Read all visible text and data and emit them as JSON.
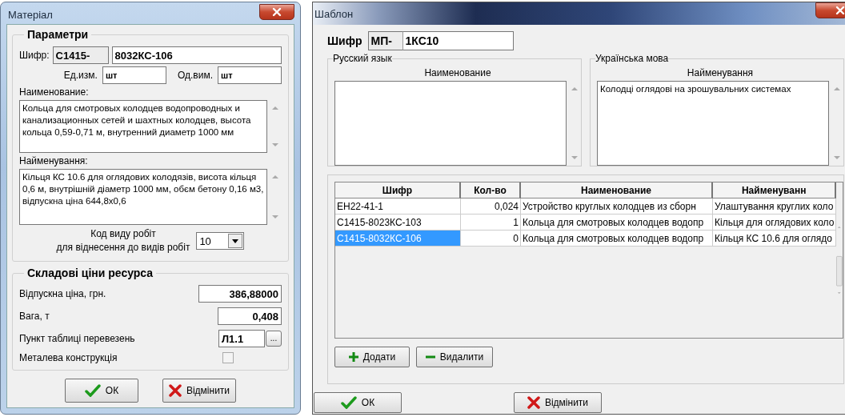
{
  "material_dialog": {
    "title": "Матеріал",
    "parameters": {
      "title": "Параметри",
      "code_label": "Шифр:",
      "code_prefix": "С1415-",
      "code_value": "8032КС-106",
      "unit_ru_label": "Ед.изм.",
      "unit_ru": "шт",
      "unit_ua_label": "Од.вим.",
      "unit_ua": "шт",
      "name_ru_label": "Наименование:",
      "name_ru": "Кольца для смотровых колодцев водопроводных и канализационных сетей и шахтных колодцев, высота кольца 0,59-0,71 м, внутренний диаметр 1000 мм",
      "name_ua_label": "Найменування:",
      "name_ua": "Кільця КС 10.6 для оглядових колодязів, висота кільця 0,6 м, внутрішній діаметр 1000 мм, обєм бетону 0,16 м3, відпускна ціна 644,8х0,6",
      "work_kind_label": "Код виду робіт\nдля віднесення до видів робіт",
      "work_kind_value": "10"
    },
    "price": {
      "title": "Складові ціни ресурса",
      "rows": [
        {
          "kind": "field",
          "label": "Відпускна ціна, грн.",
          "value": "386,88000"
        },
        {
          "kind": "field",
          "label": "Вага, т",
          "value": "0,408"
        },
        {
          "kind": "picker",
          "label": "Пункт таблиці перевезень",
          "value": "Л1.1",
          "button_text": "..."
        },
        {
          "kind": "checkbox",
          "label": "Металева конструкція",
          "checked": false
        }
      ]
    },
    "buttons": [
      {
        "label": "ОК",
        "kind": "ok"
      },
      {
        "label": "Відмінити",
        "kind": "cancel"
      }
    ]
  },
  "template_dialog": {
    "title": "Шаблон",
    "code_label": "Шифр",
    "code_prefix": "МП-",
    "code_value": "1КС10",
    "ru": {
      "group": "Русский язык",
      "label": "Наименование"
    },
    "ua": {
      "group": "Українська мова",
      "label": "Найменування",
      "text": "Колодці оглядові на зрошувальних системах"
    },
    "table": {
      "columns": [
        "Шифр",
        "Кол-во",
        "Наименование",
        "Найменуванн"
      ],
      "rows": [
        {
          "cells": [
            "ЕН22-41-1",
            "0,024",
            "Устройство круглых колодцев из сборн",
            "Улаштування круглих коло"
          ],
          "selected": false
        },
        {
          "cells": [
            "С1415-8023КС-103",
            "1",
            "Кольца для смотровых колодцев водопр",
            "Кільця для оглядових коло"
          ],
          "selected": false
        },
        {
          "cells": [
            "С1415-8032КС-106",
            "0",
            "Кольца для смотровых колодцев водопр",
            "Кільця КС 10.6 для оглядо"
          ],
          "selected": true
        }
      ]
    },
    "actions": [
      {
        "label": "Додати",
        "kind": "add"
      },
      {
        "label": "Видалити",
        "kind": "delete"
      }
    ],
    "buttons": [
      {
        "label": "ОК",
        "kind": "ok"
      },
      {
        "label": "Відмінити",
        "kind": "cancel"
      }
    ]
  }
}
